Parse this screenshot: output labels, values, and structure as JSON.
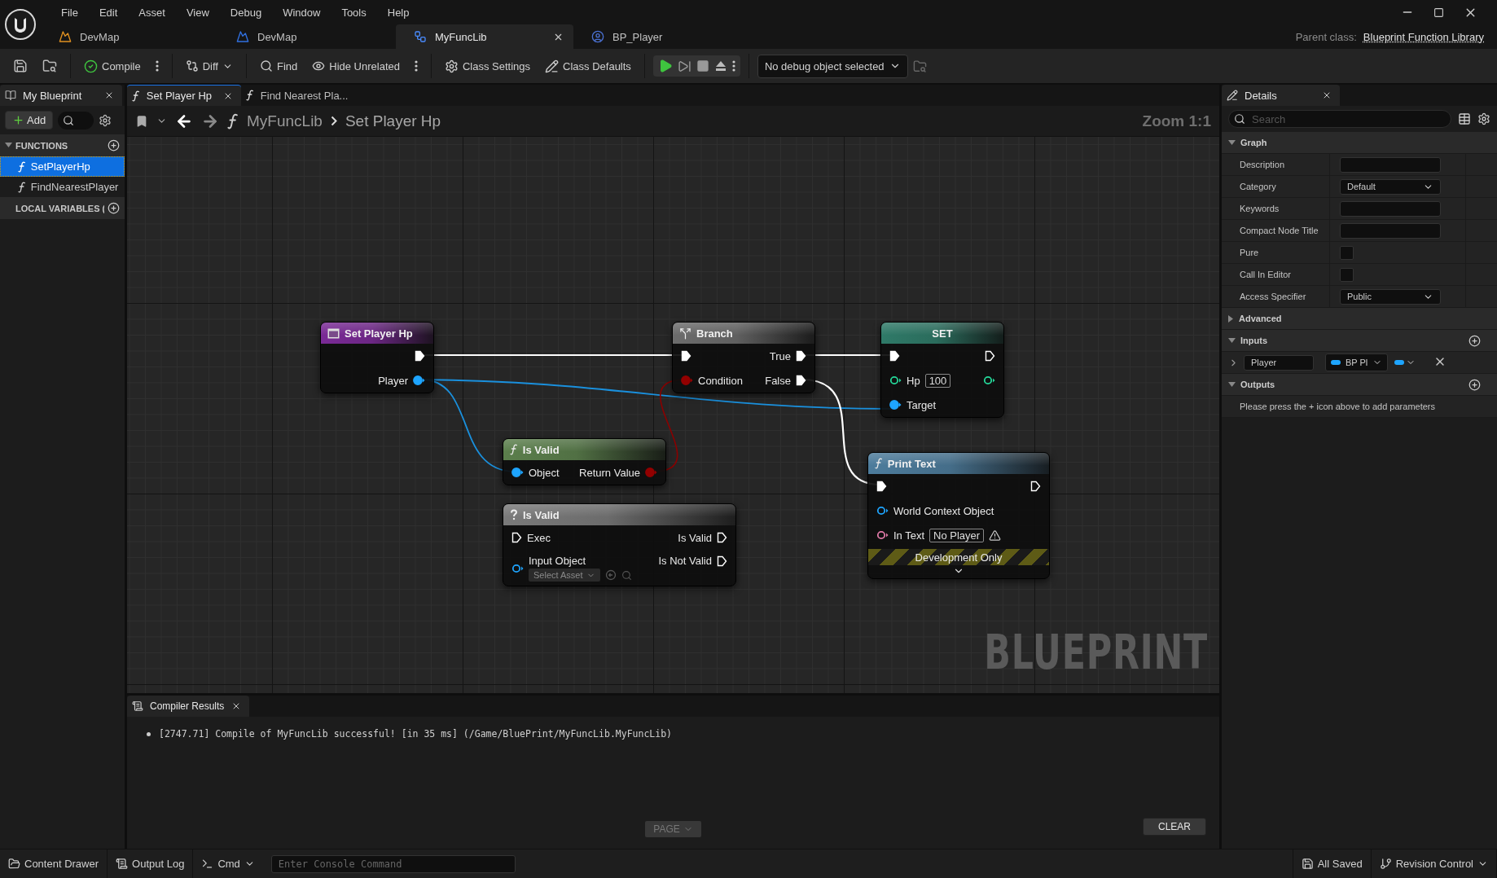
{
  "menu": [
    "File",
    "Edit",
    "Asset",
    "View",
    "Debug",
    "Window",
    "Tools",
    "Help"
  ],
  "asset_tabs": [
    {
      "label": "DevMap",
      "selected": false
    },
    {
      "label": "DevMap",
      "selected": false
    },
    {
      "label": "MyFuncLib",
      "selected": true
    },
    {
      "label": "BP_Player",
      "selected": false
    }
  ],
  "parent_class": {
    "label": "Parent class:",
    "value": "Blueprint Function Library"
  },
  "toolbar": {
    "compile": "Compile",
    "diff": "Diff",
    "find": "Find",
    "hide_unrelated": "Hide Unrelated",
    "class_settings": "Class Settings",
    "class_defaults": "Class Defaults",
    "debug_object": "No debug object selected"
  },
  "my_blueprint": {
    "tab": "My Blueprint",
    "add_button": "Add",
    "sections": [
      {
        "title": "FUNCTIONS",
        "expanded": true,
        "items": [
          {
            "label": "SetPlayerHp",
            "selected": true
          },
          {
            "label": "FindNearestPlayer",
            "selected": false
          }
        ]
      },
      {
        "title": "LOCAL VARIABLES ("
      }
    ]
  },
  "graph_tabs": [
    {
      "label": "Set Player Hp",
      "selected": true
    },
    {
      "label": "Find Nearest Pla...",
      "selected": false
    }
  ],
  "breadcrumb": [
    "MyFuncLib",
    "Set Player Hp"
  ],
  "zoom": "Zoom 1:1",
  "watermark": "BLUEPRINT",
  "nodes": [
    {
      "title": "Set Player Hp",
      "kind": "event",
      "color": "#7a2a96",
      "rows": [
        {
          "right": {
            "kind": "exec",
            "connected": true
          }
        },
        {
          "right": {
            "kind": "data",
            "label": "Player",
            "color": "#1ea5ff",
            "connected": true
          }
        }
      ]
    },
    {
      "title": "Branch",
      "kind": "branch",
      "color": "#6c6c6c",
      "rows": [
        {
          "left": {
            "kind": "exec",
            "connected": true
          },
          "right": {
            "kind": "exec",
            "label": "True",
            "connected": true
          }
        },
        {
          "left": {
            "kind": "data",
            "label": "Condition",
            "color": "#930000",
            "connected": true
          },
          "right": {
            "kind": "exec",
            "label": "False",
            "connected": true
          }
        }
      ]
    },
    {
      "title": "SET",
      "kind": "variable",
      "color": "#2f7a68",
      "rows": [
        {
          "left": {
            "kind": "exec",
            "connected": true
          },
          "right": {
            "kind": "exec",
            "connected": false
          }
        },
        {
          "left": {
            "kind": "data",
            "label": "Hp",
            "color": "#25d99a",
            "connected": false,
            "value": "100"
          },
          "right": {
            "kind": "data",
            "color": "#25d99a",
            "connected": false
          }
        },
        {
          "left": {
            "kind": "data",
            "label": "Target",
            "color": "#1ea5ff",
            "connected": true
          }
        }
      ]
    },
    {
      "title": "Is Valid",
      "kind": "function",
      "color": "#5b7f4c",
      "rows": [
        {
          "left": {
            "kind": "data",
            "label": "Object",
            "color": "#1ea5ff",
            "connected": true
          },
          "right": {
            "kind": "data",
            "label": "Return Value",
            "color": "#930000",
            "connected": true
          }
        }
      ]
    },
    {
      "title": "Is Valid",
      "kind": "macro",
      "color": "#7a7a7a",
      "rows": [
        {
          "left": {
            "kind": "exec",
            "label": "Exec",
            "connected": false
          },
          "right": {
            "kind": "exec",
            "label": "Is Valid",
            "connected": false
          }
        },
        {
          "left": {
            "kind": "data",
            "label": "Input Object",
            "color": "#1ea5ff",
            "connected": false,
            "picker": "Select Asset"
          },
          "right": {
            "kind": "exec",
            "label": "Is Not Valid",
            "connected": false
          }
        }
      ]
    },
    {
      "title": "Print Text",
      "kind": "function",
      "color": "#4d7c9c",
      "rows": [
        {
          "left": {
            "kind": "exec",
            "connected": true
          },
          "right": {
            "kind": "exec",
            "connected": false
          }
        },
        {
          "left": {
            "kind": "data",
            "label": "World Context Object",
            "color": "#1ea5ff",
            "connected": false
          }
        },
        {
          "left": {
            "kind": "data",
            "label": "In Text",
            "color": "#e07aa8",
            "connected": false,
            "value": "No Player",
            "warning": true
          }
        }
      ],
      "dev_only": {
        "label": "Development Only",
        "expanded": false
      }
    }
  ],
  "compiler": {
    "tab": "Compiler Results",
    "messages": [
      "[2747.71] Compile of MyFuncLib successful! [in 35 ms] (/Game/BluePrint/MyFuncLib.MyFuncLib)"
    ],
    "page_button": {
      "label": "PAGE",
      "disabled": true
    },
    "clear_button": "CLEAR"
  },
  "details": {
    "tab": "Details",
    "search": {
      "placeholder": "Search"
    },
    "sections": [
      {
        "title": "Graph",
        "expanded": true,
        "rows": [
          {
            "kind": "text",
            "name": "Description"
          },
          {
            "kind": "combo",
            "name": "Category",
            "value": "Default"
          },
          {
            "kind": "text",
            "name": "Keywords"
          },
          {
            "kind": "text",
            "name": "Compact Node Title"
          },
          {
            "kind": "checkbox",
            "name": "Pure",
            "checked": false
          },
          {
            "kind": "checkbox",
            "name": "Call In Editor",
            "checked": false
          },
          {
            "kind": "select",
            "name": "Access Specifier",
            "value": "Public"
          }
        ]
      },
      {
        "title": "Advanced",
        "expanded": false
      },
      {
        "title": "Inputs",
        "expanded": true,
        "add": true,
        "rows": [
          {
            "kind": "param",
            "name": "Player",
            "type": "BP Pl"
          }
        ]
      },
      {
        "title": "Outputs",
        "expanded": true,
        "add": true,
        "rows": [
          {
            "kind": "note",
            "text": "Please press the + icon above to add parameters"
          }
        ]
      }
    ]
  },
  "status_bar": {
    "content_drawer": "Content Drawer",
    "output_log": "Output Log",
    "cmd": "Cmd",
    "console_placeholder": "Enter Console Command",
    "saved": "All Saved",
    "revision_control": "Revision Control"
  }
}
